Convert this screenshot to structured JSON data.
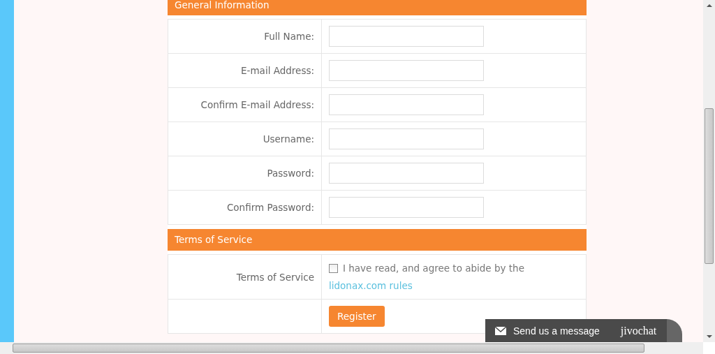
{
  "sections": [
    {
      "title": "General Information",
      "rows": [
        {
          "kind": "input",
          "label": "Full Name:"
        },
        {
          "kind": "input",
          "label": "E-mail Address:"
        },
        {
          "kind": "input",
          "label": "Confirm E-mail Address:"
        },
        {
          "kind": "input",
          "label": "Username:"
        },
        {
          "kind": "input",
          "label": "Password:"
        },
        {
          "kind": "input",
          "label": "Confirm Password:"
        }
      ]
    },
    {
      "title": "Terms of Service",
      "rows": [
        {
          "kind": "checkbox",
          "label": "Terms of Service",
          "checked": false,
          "text": "I have read, and agree to abide by the",
          "link": "lidonax.com rules"
        },
        {
          "kind": "button",
          "button": "Register"
        }
      ]
    }
  ],
  "chat": {
    "label": "Send us a message",
    "brand": "jivochat"
  }
}
